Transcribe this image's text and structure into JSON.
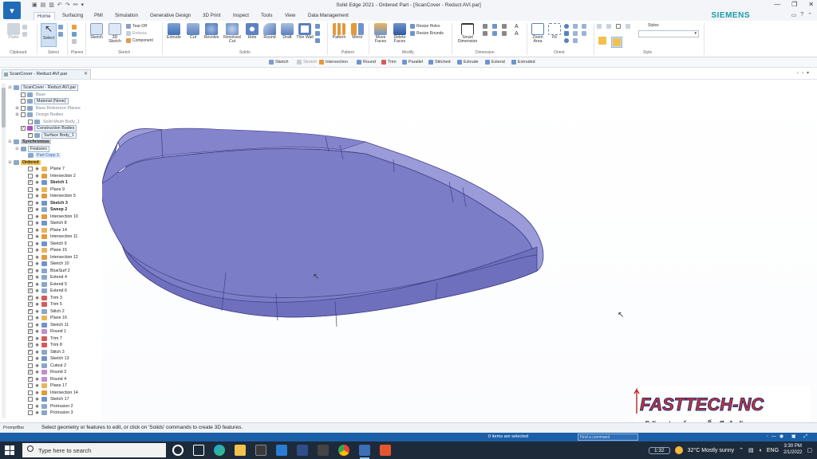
{
  "window": {
    "title": "Solid Edge 2021 - Ordered Part - [ScanCover - Reduct AVI.par]",
    "controls": [
      "—",
      "❐",
      "✕"
    ]
  },
  "ribbon_tabs": [
    "Home",
    "Surfacing",
    "PMI",
    "Simulation",
    "Generative Design",
    "3D Print",
    "Inspect",
    "Tools",
    "View",
    "Data Management"
  ],
  "brand": "SIEMENS",
  "ribbon": {
    "clipboard": {
      "paste": "Paste",
      "group": "Clipboard"
    },
    "select": {
      "label": "Select",
      "group": "Select"
    },
    "planes": {
      "group": "Planes"
    },
    "sketch": {
      "sketch": "Sketch",
      "sketch3d": "3D Sketch",
      "tear_off": "Tear-Off",
      "emboss": "Emboss",
      "component": "Component",
      "group": "Sketch"
    },
    "solids": {
      "extrude": "Extrude",
      "cut": "Cut",
      "revolve": "Revolve",
      "revolved_cut": "Revolved Cut",
      "hole": "Hole",
      "round": "Round",
      "draft": "Draft",
      "thin_wall": "Thin Wall",
      "group": "Solids"
    },
    "pattern": {
      "pattern": "Pattern",
      "mirror": "Mirror",
      "group": "Pattern"
    },
    "modify": {
      "move_faces": "Move Faces",
      "delete_faces": "Delete Faces",
      "resize_holes": "Resize Holes",
      "resize_rounds": "Resize Rounds",
      "group": "Modify"
    },
    "dimension": {
      "smart_dimension": "Smart Dimension",
      "group": "Dimension"
    },
    "orient": {
      "zoom_area": "Zoom Area",
      "fit": "Fit",
      "group": "Orient"
    },
    "style": {
      "styles_label": "Styles",
      "group": "Style"
    }
  },
  "command_bar": [
    "Sketch",
    "Stretch",
    "Intersection",
    "Round",
    "Trim",
    "Parallel",
    "Stitched",
    "Extrude",
    "Extend",
    "Extruded"
  ],
  "doc_tab": {
    "label": "ScanCover - Reduct AVI.par"
  },
  "tree": [
    {
      "label": "ScanCover - Reduct AVI.par",
      "style": "boxed"
    },
    {
      "label": "Base",
      "style": "grey"
    },
    {
      "label": "Material (None)",
      "style": "boxed"
    },
    {
      "label": "Base Reference Planes",
      "style": "grey"
    },
    {
      "label": "Design Bodies",
      "style": "grey"
    },
    {
      "label": "Solid Mesh Body_1",
      "style": "grey"
    },
    {
      "label": "Construction Bodies",
      "style": "boxed"
    },
    {
      "label": "Surface Body_1",
      "style": "boxed"
    },
    {
      "label": "Synchronous",
      "style": "hl-grey"
    },
    {
      "label": "Features",
      "style": "boxed"
    },
    {
      "label": "Part Copy 1",
      "style": "hl-blue"
    },
    {
      "label": "Ordered",
      "style": "hl-yellow"
    },
    {
      "label": "Plane 7"
    },
    {
      "label": "Intersection 2"
    },
    {
      "label": "Sketch 1",
      "style": "bold"
    },
    {
      "label": "Plane 9"
    },
    {
      "label": "Intersection 5"
    },
    {
      "label": "Sketch 3",
      "style": "bold"
    },
    {
      "label": "Sweep 2",
      "style": "bold"
    },
    {
      "label": "Intersection 10"
    },
    {
      "label": "Sketch 8"
    },
    {
      "label": "Plane 14"
    },
    {
      "label": "Intersection 11"
    },
    {
      "label": "Sketch 9"
    },
    {
      "label": "Plane 15"
    },
    {
      "label": "Intersection 12"
    },
    {
      "label": "Sketch 10"
    },
    {
      "label": "BlueSurf 2"
    },
    {
      "label": "Extend 4"
    },
    {
      "label": "Extend 5"
    },
    {
      "label": "Extend 6"
    },
    {
      "label": "Trim 3"
    },
    {
      "label": "Trim 5"
    },
    {
      "label": "Stitch 2"
    },
    {
      "label": "Plane 16"
    },
    {
      "label": "Sketch 11"
    },
    {
      "label": "Round 1"
    },
    {
      "label": "Trim 7"
    },
    {
      "label": "Trim 8"
    },
    {
      "label": "Stitch 3"
    },
    {
      "label": "Sketch 13"
    },
    {
      "label": "Cutout 2"
    },
    {
      "label": "Round 3"
    },
    {
      "label": "Round 4"
    },
    {
      "label": "Plane 17"
    },
    {
      "label": "Intersection 14"
    },
    {
      "label": "Sketch 17"
    },
    {
      "label": "Protrusion 2"
    },
    {
      "label": "Protrusion 3"
    }
  ],
  "prompt_bar": {
    "title": "PromptBar",
    "text": "Select geometry or features to edit, or click on 'Solids' commands to create 3D features."
  },
  "status_bar": {
    "selected": "0 items are selected",
    "find": "Find a command"
  },
  "watermark": {
    "brand": "FASTTECH-NC",
    "thai": "บริษัท ฟาสท์เทค เอ็นซี จำกัด"
  },
  "colors": {
    "part_fill": "#7c7dc7",
    "part_edge": "#3e3f86",
    "status_blue": "#1b5fa8",
    "siemens_teal": "#1a9aa8"
  },
  "taskbar": {
    "search_placeholder": "Type here to search",
    "meeting_time": "1:32",
    "weather": "32°C  Mostly sunny",
    "language": "ENG",
    "time": "3:30 PM",
    "date": "2/1/2022"
  }
}
